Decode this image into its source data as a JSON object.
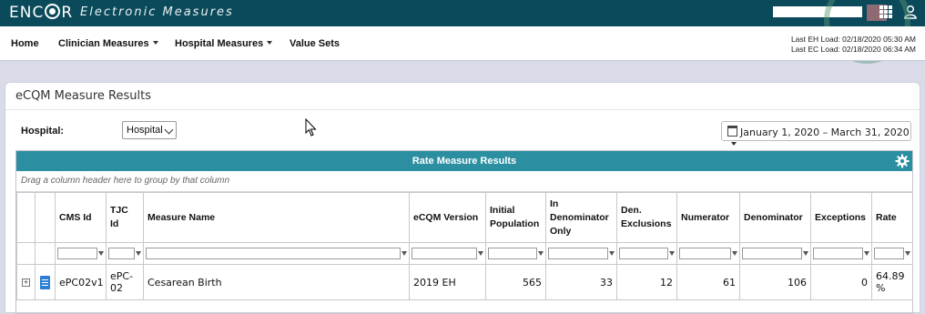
{
  "app": {
    "brand": "ENCOR",
    "subtitle": "Electronic Measures"
  },
  "nav": {
    "home": "Home",
    "clinician": "Clinician Measures",
    "hospital": "Hospital Measures",
    "value_sets": "Value Sets",
    "last_eh": "Last EH Load: 02/18/2020 05:30 AM",
    "last_ec": "Last EC Load: 02/18/2020 06:34 AM"
  },
  "panel": {
    "title": "eCQM Measure Results",
    "hospital_label": "Hospital:",
    "hospital_value": "Hospital",
    "date_range": "January 1, 2020 – March 31, 2020"
  },
  "grid": {
    "title": "Rate Measure Results",
    "group_hint": "Drag a column header here to group by that column",
    "columns": [
      "CMS Id",
      "TJC Id",
      "Measure Name",
      "eCQM Version",
      "Initial Population",
      "In Denominator Only",
      "Den. Exclusions",
      "Numerator",
      "Denominator",
      "Exceptions",
      "Rate"
    ],
    "rows": [
      {
        "cms_id": "ePC02v1",
        "tjc_id": "ePC-02",
        "name": "Cesarean Birth",
        "version": "2019 EH",
        "initial_population": "565",
        "in_denominator_only": "33",
        "den_exclusions": "12",
        "numerator": "61",
        "denominator": "106",
        "exceptions": "0",
        "rate": "64.89 %"
      }
    ]
  },
  "icons": [
    "apps-grid-icon",
    "user-icon",
    "calendar-icon",
    "gear-icon",
    "filter-icon",
    "expand-icon",
    "document-icon",
    "mouse-cursor-icon"
  ],
  "colors": {
    "topbar": "#0b4a5a",
    "grid_header": "#2b8fa1",
    "doc_icon": "#2a7fd4"
  }
}
